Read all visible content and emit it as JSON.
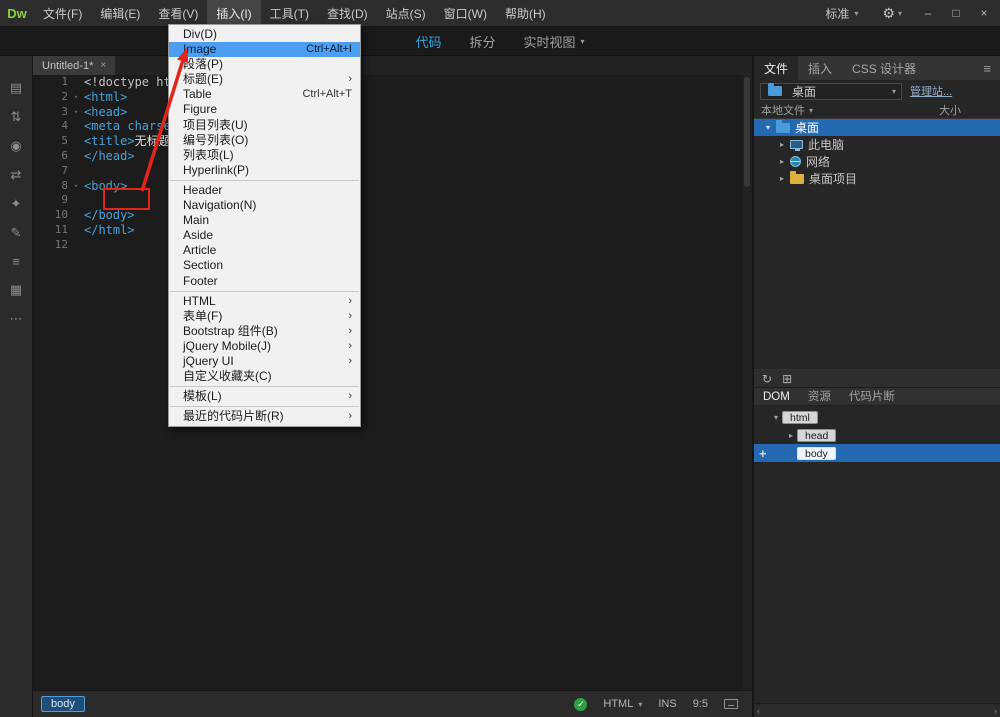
{
  "titlebar": {
    "logo": "Dw",
    "menus": [
      {
        "label": "文件(F)"
      },
      {
        "label": "编辑(E)"
      },
      {
        "label": "查看(V)"
      },
      {
        "label": "插入(I)",
        "open": true
      },
      {
        "label": "工具(T)"
      },
      {
        "label": "查找(D)"
      },
      {
        "label": "站点(S)"
      },
      {
        "label": "窗口(W)"
      },
      {
        "label": "帮助(H)"
      }
    ],
    "workspace_label": "标准",
    "window_controls": {
      "minimize": "–",
      "maximize": "□",
      "close": "×"
    }
  },
  "view_toolbar": {
    "items": [
      {
        "label": "代码",
        "active": true
      },
      {
        "label": "拆分"
      },
      {
        "label": "实时视图",
        "dropdown": true
      }
    ]
  },
  "document_tab": {
    "title": "Untitled-1*"
  },
  "insert_menu": {
    "items": [
      {
        "label": "Div(D)"
      },
      {
        "label": "Image",
        "shortcut": "Ctrl+Alt+I",
        "highlighted": true
      },
      {
        "label": "段落(P)"
      },
      {
        "label": "标题(E)",
        "submenu": true
      },
      {
        "label": "Table",
        "shortcut": "Ctrl+Alt+T"
      },
      {
        "label": "Figure"
      },
      {
        "label": "项目列表(U)"
      },
      {
        "label": "编号列表(O)"
      },
      {
        "label": "列表项(L)"
      },
      {
        "label": "Hyperlink(P)"
      },
      {
        "separator": true
      },
      {
        "label": "Header"
      },
      {
        "label": "Navigation(N)"
      },
      {
        "label": "Main"
      },
      {
        "label": "Aside"
      },
      {
        "label": "Article"
      },
      {
        "label": "Section"
      },
      {
        "label": "Footer"
      },
      {
        "separator": true
      },
      {
        "label": "HTML",
        "submenu": true
      },
      {
        "label": "表单(F)",
        "submenu": true
      },
      {
        "label": "Bootstrap 组件(B)",
        "submenu": true
      },
      {
        "label": "jQuery Mobile(J)",
        "submenu": true
      },
      {
        "label": "jQuery UI",
        "submenu": true
      },
      {
        "label": "自定义收藏夹(C)"
      },
      {
        "separator": true
      },
      {
        "label": "模板(L)",
        "submenu": true
      },
      {
        "separator": true
      },
      {
        "label": "最近的代码片断(R)",
        "submenu": true
      }
    ]
  },
  "left_toolbar": {
    "icons": [
      {
        "name": "open-documents-icon",
        "glyph": "▤"
      },
      {
        "name": "file-management-icon",
        "glyph": "⇅"
      },
      {
        "name": "live-view-icon",
        "glyph": "◉"
      },
      {
        "name": "swap-views-icon",
        "glyph": "⇄"
      },
      {
        "name": "inspect-icon",
        "glyph": "✦"
      },
      {
        "name": "edit-icon",
        "glyph": "✎"
      },
      {
        "name": "format-source-icon",
        "glyph": "≡"
      },
      {
        "name": "snippets-icon",
        "glyph": "▦"
      },
      {
        "name": "more-options-icon",
        "glyph": "⋯"
      }
    ]
  },
  "code_editor": {
    "lines": [
      {
        "num": "1",
        "tokens": [
          {
            "text": "<!doctype ht",
            "type": "plain"
          }
        ]
      },
      {
        "num": "2",
        "fold": true,
        "tokens": [
          {
            "text": "<html>",
            "type": "tag"
          }
        ]
      },
      {
        "num": "3",
        "fold": true,
        "tokens": [
          {
            "text": "<head>",
            "type": "tag"
          }
        ]
      },
      {
        "num": "4",
        "tokens": [
          {
            "text": "<meta charse",
            "type": "tag"
          }
        ]
      },
      {
        "num": "5",
        "tokens": [
          {
            "text": "<title>",
            "type": "tag"
          },
          {
            "text": "无标题",
            "type": "text"
          }
        ]
      },
      {
        "num": "6",
        "tokens": [
          {
            "text": "</head>",
            "type": "tag"
          }
        ]
      },
      {
        "num": "7",
        "tokens": []
      },
      {
        "num": "8",
        "fold": true,
        "tokens": [
          {
            "text": "<body>",
            "type": "tag"
          }
        ]
      },
      {
        "num": "9",
        "tokens": []
      },
      {
        "num": "10",
        "tokens": [
          {
            "text": "</body>",
            "type": "tag"
          }
        ]
      },
      {
        "num": "11",
        "tokens": [
          {
            "text": "</html>",
            "type": "tag"
          }
        ]
      },
      {
        "num": "12",
        "tokens": []
      }
    ]
  },
  "files_panel": {
    "tabs": [
      {
        "label": "文件",
        "active": true
      },
      {
        "label": "插入"
      },
      {
        "label": "CSS 设计器"
      }
    ],
    "site_name": "桌面",
    "manage_sites_label": "管理站...",
    "local_files_label": "本地文件",
    "size_label": "大小",
    "tree": [
      {
        "label": "桌面",
        "icon": "desktop",
        "level": 0,
        "expanded": true,
        "selected": true
      },
      {
        "label": "此电脑",
        "icon": "computer",
        "level": 1,
        "expanded": false
      },
      {
        "label": "网络",
        "icon": "network",
        "level": 1,
        "expanded": false
      },
      {
        "label": "桌面项目",
        "icon": "folder",
        "level": 1,
        "expanded": false
      }
    ]
  },
  "dom_panel": {
    "tabs": [
      {
        "label": "DOM",
        "active": true
      },
      {
        "label": "资源"
      },
      {
        "label": "代码片断"
      }
    ],
    "tree": [
      {
        "tag": "html",
        "level": 0,
        "expanded": true
      },
      {
        "tag": "head",
        "level": 1,
        "expanded": false
      },
      {
        "tag": "body",
        "level": 1,
        "leaf": true,
        "selected": true,
        "plus": true
      }
    ],
    "add_icon": "+"
  },
  "status_bar": {
    "tag_selector": "body",
    "ok_icon": "✓",
    "doc_type": "HTML",
    "insert_mode": "INS",
    "cursor_position": "9:5"
  },
  "icons": {
    "caret_down": "▾",
    "expander_open": "▾",
    "expander_closed": "▸",
    "submenu_arrow": "›",
    "gear": "⚙",
    "panel_menu": "≡",
    "close_tab": "×",
    "refresh": "↻",
    "connect": "⊞",
    "scroll_left": "‹",
    "scroll_right": "›"
  },
  "colors": {
    "accent_blue": "#2569b2",
    "menu_highlight": "#4d9df0",
    "annotation_red": "#e1251b",
    "logo_green": "#8bd13f",
    "code_view_active": "#35a3e0"
  }
}
